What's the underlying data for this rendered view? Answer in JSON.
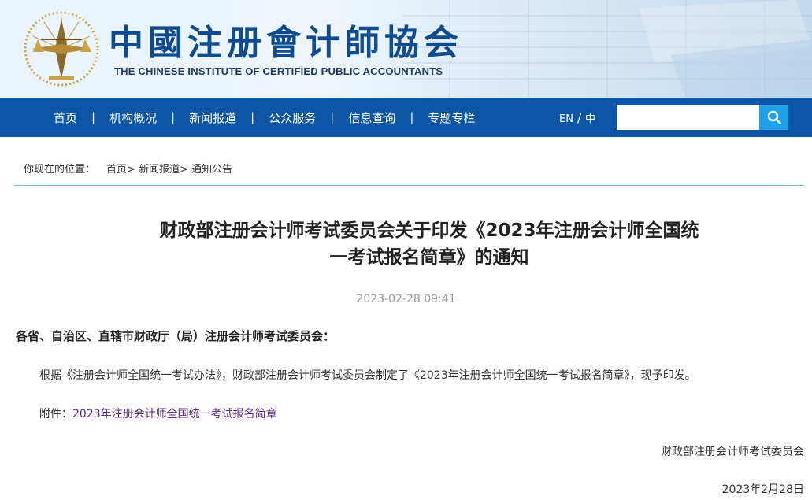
{
  "header": {
    "title_cn": "中國注册會计師協会",
    "title_en": "THE CHINESE INSTITUTE OF CERTIFIED PUBLIC ACCOUNTANTS"
  },
  "nav": {
    "items": [
      {
        "label": "首页"
      },
      {
        "label": "机构概况"
      },
      {
        "label": "新闻报道"
      },
      {
        "label": "公众服务"
      },
      {
        "label": "信息查询"
      },
      {
        "label": "专题专栏"
      }
    ],
    "separator": "|",
    "lang_en": "EN",
    "lang_slash": "/",
    "lang_cn": "中",
    "search_value": "",
    "search_placeholder": ""
  },
  "breadcrumb": {
    "prefix": "你现在的位置：",
    "items": [
      "首页",
      "新闻报道",
      "通知公告"
    ],
    "separator": ">"
  },
  "article": {
    "title_line1": "财政部注册会计师考试委员会关于印发《2023年注册会计师全国统",
    "title_line2": "一考试报名简章》的通知",
    "datetime": "2023-02-28 09:41",
    "salutation": "各省、自治区、直辖市财政厅（局）注册会计师考试委员会：",
    "paragraph": "根据《注册会计师全国统一考试办法》，财政部注册会计师考试委员会制定了《2023年注册会计师全国统一考试报名简章》，现予印发。",
    "attachment_label": "附件：",
    "attachment_link": "2023年注册会计师全国统一考试报名简章",
    "signature": "财政部注册会计师考试委员会",
    "sign_date": "2023年2月28日"
  },
  "colors": {
    "nav_bg": "#0d56a6",
    "search_button": "#1ea0e8",
    "title_blue": "#0f4c8f",
    "divider": "#7bbcd2",
    "link": "#5b2a86"
  },
  "icons": {
    "search": "search-icon",
    "logo": "cicpa-emblem-icon"
  }
}
